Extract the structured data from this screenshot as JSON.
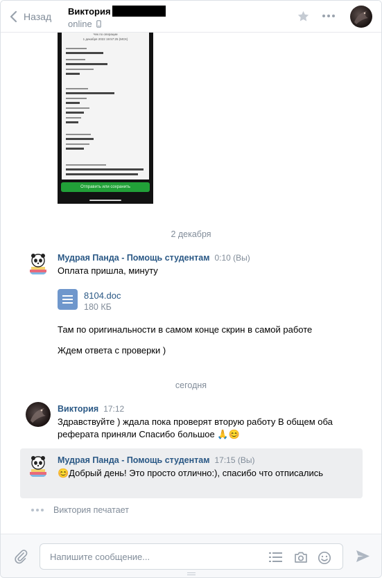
{
  "header": {
    "back_label": "Назад",
    "peer_name": "Виктория",
    "peer_status": "online"
  },
  "date_separators": {
    "first": "2 декабря",
    "second": "сегодня"
  },
  "messages": [
    {
      "author": "Мудрая Панда - Помощь студентам",
      "time": "0:10 (Вы)",
      "text": "Оплата пришла, минуту",
      "attachment": {
        "name": "8104.doc",
        "size": "180 КБ"
      },
      "extra_lines": [
        "Там по оригинальности в самом конце скрин в самой работе",
        "Ждем ответа с проверки )"
      ]
    },
    {
      "author": "Виктория",
      "time": "17:12",
      "text": "Здравствуйте ) ждала пока проверят вторую работу В общем оба реферата приняли Спасибо большое 🙏😊"
    },
    {
      "author": "Мудрая Панда - Помощь студентам",
      "time": "17:15 (Вы)",
      "text": "😊Добрый день! Это просто отлично:), спасибо что отписались"
    }
  ],
  "typing": "Виктория печатает",
  "composer": {
    "placeholder": "Напишите сообщение..."
  },
  "colors": {
    "link_blue": "#2a5885",
    "muted_gray": "#818c99",
    "highlight_bg": "#edeef0",
    "doc_icon": "#6f97cc",
    "pay_button_green": "#21a038"
  },
  "screenshot_preview": {
    "header_text": "Чек по операции",
    "date_text": "1 декабря 2022 19:57:25 (МСК)",
    "button_label": "Отправить или сохранить"
  }
}
